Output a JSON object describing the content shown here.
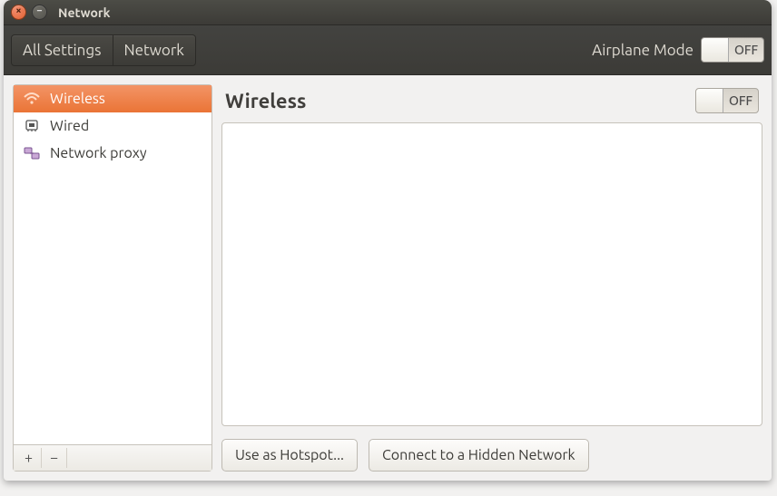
{
  "window": {
    "title": "Network"
  },
  "toolbar": {
    "crumb_all_settings": "All Settings",
    "crumb_network": "Network",
    "airplane_label": "Airplane Mode",
    "airplane_state": "OFF"
  },
  "sidebar": {
    "items": [
      {
        "label": "Wireless",
        "icon": "wifi"
      },
      {
        "label": "Wired",
        "icon": "ethernet"
      },
      {
        "label": "Network proxy",
        "icon": "proxy"
      }
    ],
    "add_label": "+",
    "remove_label": "−"
  },
  "main": {
    "title": "Wireless",
    "toggle_state": "OFF",
    "hotspot_button": "Use as Hotspot...",
    "hidden_network_button": "Connect to a Hidden Network"
  }
}
